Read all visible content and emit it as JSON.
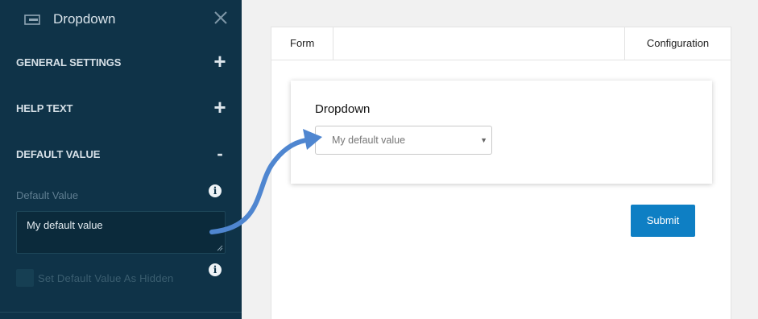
{
  "sidebar": {
    "title": "Dropdown",
    "header_icon": "dropdown-icon",
    "close_icon": "close-icon",
    "sections": [
      {
        "label": "GENERAL SETTINGS",
        "toggle": "+"
      },
      {
        "label": "HELP TEXT",
        "toggle": "+"
      },
      {
        "label": "DEFAULT VALUE",
        "toggle": "-"
      }
    ],
    "default_value": {
      "label": "Default Value",
      "info": "i",
      "value": "My default value"
    },
    "hidden_option": {
      "label": "Set Default Value As Hidden",
      "info": "i",
      "checked": false
    }
  },
  "main": {
    "tabs": [
      {
        "label": "Form"
      },
      {
        "label": "Configuration"
      }
    ],
    "form": {
      "question_label": "Dropdown",
      "select_value": "My default value",
      "caret": "▼"
    },
    "submit_label": "Submit"
  },
  "colors": {
    "sidebar_bg": "#0f3348",
    "accent": "#0e7fc4",
    "arrow": "#4f86d0"
  }
}
